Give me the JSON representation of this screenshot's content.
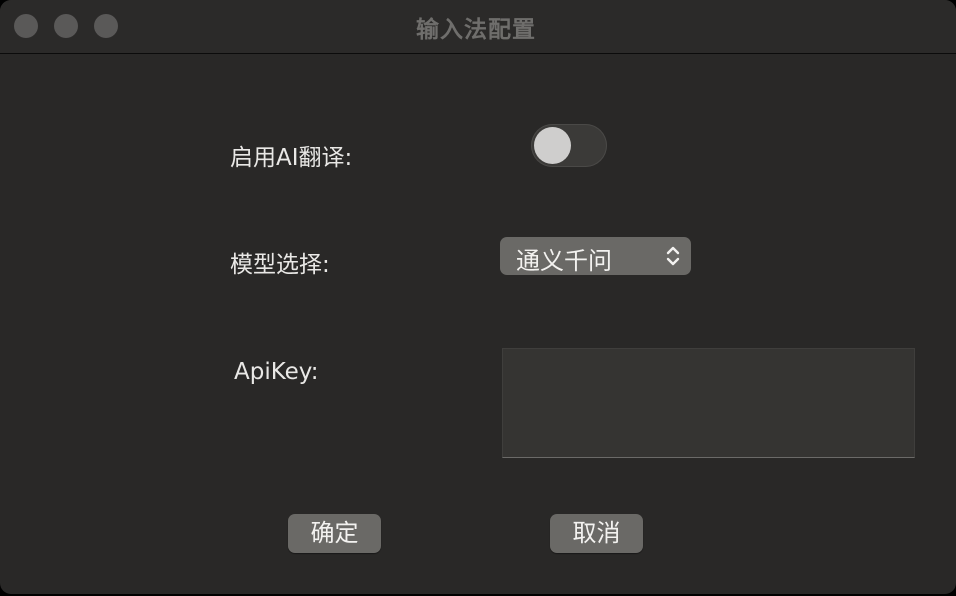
{
  "window": {
    "title": "输入法配置"
  },
  "form": {
    "ai_translate_label": "启用AI翻译:",
    "ai_translate_enabled": false,
    "model_label": "模型选择:",
    "model_selected": "通义千问",
    "apikey_label": "ApiKey:",
    "apikey_value": ""
  },
  "buttons": {
    "ok_label": "确定",
    "cancel_label": "取消"
  },
  "colors": {
    "window_bg": "#292827",
    "button_bg": "#6a6966",
    "text": "#e9e8e6"
  }
}
